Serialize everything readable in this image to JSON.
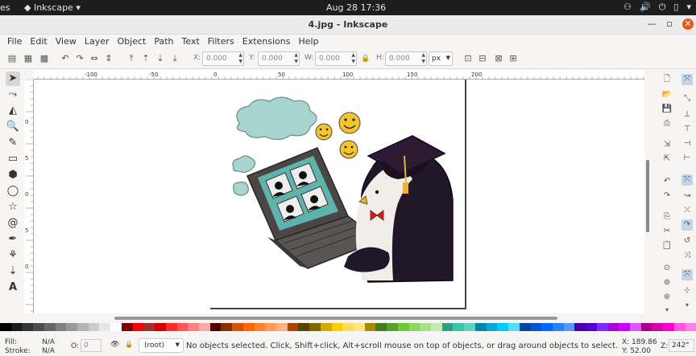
{
  "system": {
    "left_partial": "es",
    "app_name": "Inkscape",
    "app_arrow": "▾",
    "clock": "Aug 28  17:36",
    "tray": [
      "⚇",
      "🔊",
      "⏻",
      "▯",
      "▾"
    ]
  },
  "window": {
    "title": "4.jpg - Inkscape",
    "minimize": "—",
    "maximize": "▫",
    "close": "✕"
  },
  "menu": [
    "File",
    "Edit",
    "View",
    "Layer",
    "Object",
    "Path",
    "Text",
    "Filters",
    "Extensions",
    "Help"
  ],
  "toolbar": {
    "x_label": "X:",
    "x_value": "0.000",
    "y_label": "Y:",
    "y_value": "0.000",
    "w_label": "W:",
    "w_value": "0.000",
    "h_label": "H:",
    "h_value": "0.000",
    "unit": "px",
    "lock_icon": "🔒",
    "icons": [
      "▤",
      "▦",
      "▩",
      "↶",
      "↷",
      "⇔",
      "⇕",
      "⤒",
      "⇡",
      "⇣",
      "⤓"
    ],
    "snap_icons": [
      "⊡",
      "⊟",
      "⊠",
      "⊞"
    ]
  },
  "tools": [
    "➤",
    "⤳",
    "◭",
    "🔍",
    "✎",
    "▭",
    "⬢",
    "◯",
    "☆",
    "@",
    "✒",
    "⚘",
    "⇣",
    "A"
  ],
  "ruler_labels": [
    "-100",
    "-50",
    "0",
    "50",
    "100",
    "150",
    "200"
  ],
  "vruler_labels": [
    "0",
    "5",
    "0",
    "5",
    "0"
  ],
  "palette": [
    "#000000",
    "#1a1a1a",
    "#333333",
    "#4d4d4d",
    "#666666",
    "#808080",
    "#999999",
    "#b3b3b3",
    "#cccccc",
    "#e6e6e6",
    "#ffffff",
    "#800000",
    "#ff0000",
    "#a02c2c",
    "#d40000",
    "#ff2a2a",
    "#ff5555",
    "#ff8080",
    "#ffaaaa",
    "#550000",
    "#803300",
    "#d45500",
    "#ff6600",
    "#ff7f2a",
    "#ff9955",
    "#ffb380",
    "#aa4400",
    "#554400",
    "#806600",
    "#d4aa00",
    "#ffcc00",
    "#ffdd55",
    "#ffe680",
    "#aa8800",
    "#447821",
    "#5aa02c",
    "#71c837",
    "#8dd35f",
    "#aade87",
    "#c6e9af",
    "#2ca089",
    "#37c8ab",
    "#5fd3bc",
    "#0088aa",
    "#00aad4",
    "#00ccff",
    "#55ddff",
    "#0044aa",
    "#0055d4",
    "#0066ff",
    "#2a7fff",
    "#5599ff",
    "#4400aa",
    "#5500d4",
    "#7f2aff",
    "#aa00d4",
    "#cc00ff",
    "#dd55ff",
    "#aa0088",
    "#d400aa",
    "#ff00cc",
    "#ff55dd",
    "#ff80e5"
  ],
  "status": {
    "fill_label": "Fill:",
    "fill_value": "N/A",
    "stroke_label": "Stroke:",
    "stroke_value": "N/A",
    "opacity_label": "O:",
    "opacity_value": "0",
    "layer": "(root)",
    "message": "No objects selected. Click, Shift+click, Alt+scroll mouse on top of objects, or drag around objects to select.",
    "x_coord": "X: 189.86",
    "y_coord": "Y:   52.00",
    "zoom_label": "Z:",
    "zoom_value": "242°"
  },
  "colors": {
    "cloud": "#a8d5cf",
    "screen": "#5fb3ad",
    "laptop": "#4a4646",
    "cap": "#2d1a33",
    "emoji": "#f4c430",
    "bow": "#d41f1f",
    "beak": "#e9b23c"
  }
}
